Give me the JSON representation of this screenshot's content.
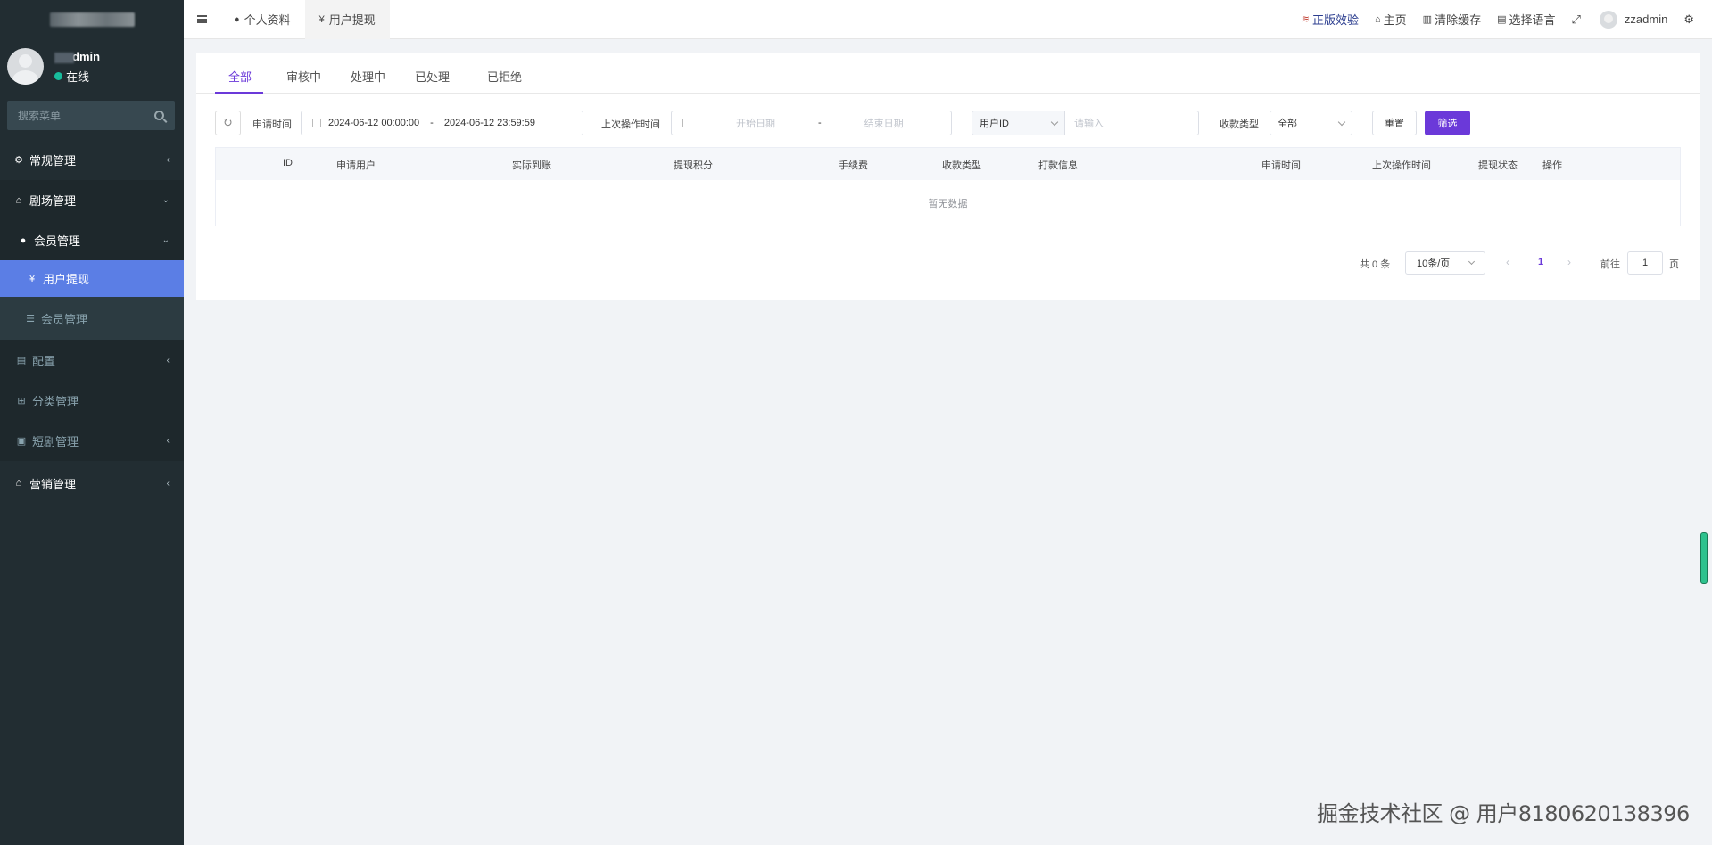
{
  "sidebar": {
    "username": "dmin",
    "status": "在线",
    "search_placeholder": "搜索菜单",
    "items": [
      {
        "label": "常规管理",
        "icon": "cogs-icon",
        "glyph": "⚙",
        "arrow": "‹"
      },
      {
        "label": "剧场管理",
        "icon": "home-icon",
        "glyph": "⌂",
        "arrow": "⌄"
      },
      {
        "label": "会员管理",
        "icon": "user-icon",
        "glyph": "●",
        "arrow": "⌄"
      },
      {
        "label": "用户提现",
        "icon": "yen-icon",
        "glyph": "¥"
      },
      {
        "label": "会员管理",
        "icon": "list-icon",
        "glyph": "☰"
      },
      {
        "label": "配置",
        "icon": "file-icon",
        "glyph": "▤",
        "arrow": "‹"
      },
      {
        "label": "分类管理",
        "icon": "sitemap-icon",
        "glyph": "⊞"
      },
      {
        "label": "短剧管理",
        "icon": "briefcase-icon",
        "glyph": "▣",
        "arrow": "‹"
      },
      {
        "label": "营销管理",
        "icon": "home-icon",
        "glyph": "⌂",
        "arrow": "‹"
      }
    ]
  },
  "topbar": {
    "tabs": [
      {
        "label": "个人资料",
        "glyph": "●"
      },
      {
        "label": "用户提现",
        "glyph": "¥"
      }
    ],
    "right": {
      "official": "正版效验",
      "home": "主页",
      "clear_cache": "清除缓存",
      "language": "选择语言",
      "user": "zzadmin"
    }
  },
  "content": {
    "tabs": [
      "全部",
      "审核中",
      "处理中",
      "已处理",
      "已拒绝"
    ],
    "filters": {
      "apply_time_label": "申请时间",
      "apply_start": "2024-06-12 00:00:00",
      "apply_end": "2024-06-12 23:59:59",
      "range_sep": "-",
      "last_op_label": "上次操作时间",
      "start_placeholder": "开始日期",
      "end_placeholder": "结束日期",
      "field_select": "用户ID",
      "field_placeholder": "请输入",
      "pay_type_label": "收款类型",
      "pay_type_value": "全部",
      "reset": "重置",
      "submit": "筛选"
    },
    "table": {
      "columns": [
        "ID",
        "申请用户",
        "实际到账",
        "提现积分",
        "手续费",
        "收款类型",
        "打款信息",
        "申请时间",
        "上次操作时间",
        "提现状态",
        "操作"
      ],
      "empty": "暂无数据"
    },
    "pagination": {
      "total": "共 0 条",
      "page_size": "10条/页",
      "current": "1",
      "goto_label": "前往",
      "goto_value": "1",
      "goto_unit": "页"
    }
  },
  "watermark": "掘金技术社区 @ 用户8180620138396"
}
